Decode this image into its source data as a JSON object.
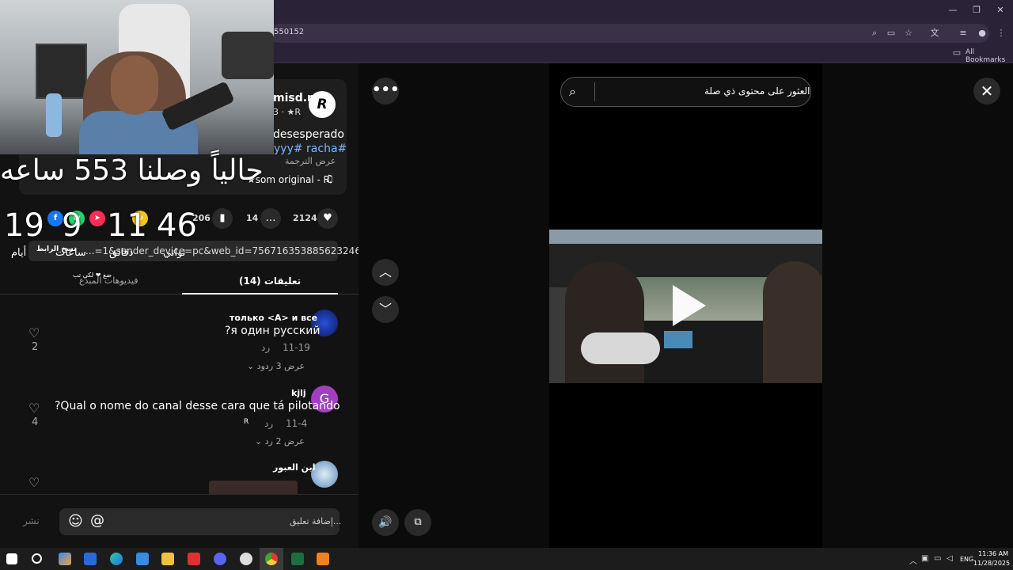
{
  "browser": {
    "url_fragment": "550152",
    "bookmarks_label": "All Bookmarks",
    "minimize": "—",
    "restore": "❐",
    "close": "✕",
    "icons": {
      "zoom": "⌕",
      "cast": "▭",
      "star": "☆",
      "translate": "文",
      "queue": "≡",
      "profile": "●",
      "menu": "⋮",
      "folder": "▭"
    }
  },
  "video_info": {
    "username": "misd.r",
    "user_sub": "3 · ★R",
    "r_logo": "R",
    "desc_line1": "desesperado",
    "desc_line2": "yyy# racha#",
    "translate": "عرض الترجمة",
    "sound": "★som original - R",
    "music_icon": "♫"
  },
  "overlay": {
    "headline": "حالياً وصلنا 553 ساعه",
    "countdown": [
      {
        "value": "19",
        "label": "أيام"
      },
      {
        "value": "9",
        "label": "ساعات"
      },
      {
        "value": "11",
        "label": "دقائق"
      },
      {
        "value": "46",
        "label": "ثواني"
      }
    ]
  },
  "actions": {
    "likes": "2124",
    "comments": "14",
    "saves": "206"
  },
  "share_link": {
    "text": "...=1&sender_device=pc&web_id=7567163538856232465",
    "copy_label": "نسخ الرابط"
  },
  "tabs": {
    "comments": "(14) تعليقات",
    "creator": "فيديوهات المبدع",
    "creator_mini": "ضع ❤ لكي تب"
  },
  "comments": [
    {
      "name": "только <A> и все",
      "text": "?я один русский",
      "date": "11-19",
      "reply": "رد",
      "more": "عرض 3 ردود",
      "likes": "2",
      "avatar_color": "#1a3fb8"
    },
    {
      "name": "kjlj",
      "text": "?Qual o nome do canal desse cara que tá pilotando",
      "date": "11-4",
      "reply": "رد",
      "more": "عرض 2 رد",
      "likes": "4",
      "avatar_letter": "G",
      "avatar_color": "#a23fc0"
    },
    {
      "name": "ابن العبور",
      "text": "",
      "likes": "",
      "avatar_color": "#8ab8e0"
    }
  ],
  "comment_box": {
    "placeholder": "إضافة تعليق...",
    "post": "نشر",
    "emoji": "☺",
    "at": "@"
  },
  "video_panel": {
    "search_text": "العثور على محتوى ذي صلة",
    "search_icon": "⌕",
    "close_icon": "✕",
    "more_icon": "•••",
    "up_icon": "︿",
    "down_icon": "﹀",
    "volume_icon": "🔊",
    "pip_icon": "⧉"
  },
  "taskbar": {
    "time": "11:36 AM",
    "date": "11/28/2025",
    "lang": "ENG",
    "icons": [
      "windows",
      "search",
      "copilot",
      "mail",
      "edge",
      "store",
      "explorer",
      "wps",
      "discord",
      "steam",
      "chrome",
      "excel",
      "vlc"
    ]
  }
}
